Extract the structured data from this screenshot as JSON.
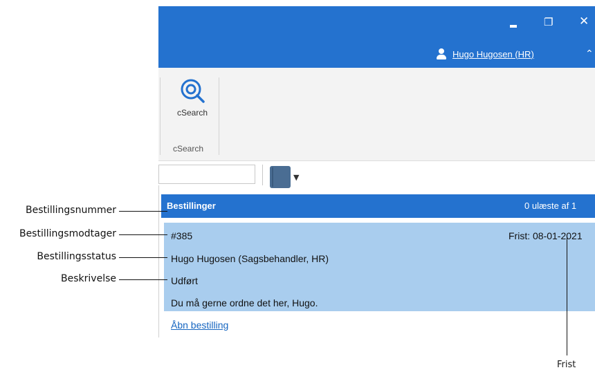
{
  "window": {
    "user_name": "Hugo Hugosen (HR)",
    "accent_color": "#2472cf"
  },
  "ribbon": {
    "csearch_button_label": "cSearch",
    "group_label": "cSearch"
  },
  "orders_panel": {
    "title": "Bestillinger",
    "unread_text": "0 ulæste af 1",
    "order": {
      "number": "#385",
      "deadline": "Frist: 08-01-2021",
      "recipient": "Hugo Hugosen (Sagsbehandler, HR)",
      "status": "Udført",
      "description": "Du må gerne ordne det her, Hugo."
    },
    "open_link": "Åbn bestilling",
    "card_color": "#a9cdee"
  },
  "annotations": {
    "number": "Bestillingsnummer",
    "recipient": "Bestillingsmodtager",
    "status": "Bestillingsstatus",
    "description": "Beskrivelse",
    "deadline": "Frist"
  }
}
